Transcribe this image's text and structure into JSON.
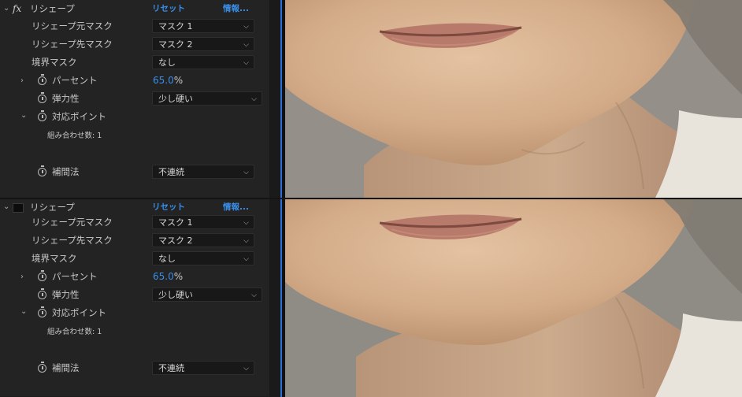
{
  "effects": [
    {
      "name": "リシェープ",
      "reset": "リセット",
      "info": "情報...",
      "source_mask_label": "リシェープ元マスク",
      "source_mask_value": "マスク 1",
      "dest_mask_label": "リシェープ先マスク",
      "dest_mask_value": "マスク 2",
      "boundary_mask_label": "境界マスク",
      "boundary_mask_value": "なし",
      "percent_label": "パーセント",
      "percent_value": "65.0",
      "percent_unit": "%",
      "elasticity_label": "弾力性",
      "elasticity_value": "少し硬い",
      "correspondence_label": "対応ポイント",
      "combinations_label": "組み合わせ数: 1",
      "interpolation_label": "補間法",
      "interpolation_value": "不連続"
    },
    {
      "name": "リシェープ",
      "reset": "リセット",
      "info": "情報...",
      "source_mask_label": "リシェープ元マスク",
      "source_mask_value": "マスク 1",
      "dest_mask_label": "リシェープ先マスク",
      "dest_mask_value": "マスク 2",
      "boundary_mask_label": "境界マスク",
      "boundary_mask_value": "なし",
      "percent_label": "パーセント",
      "percent_value": "65.0",
      "percent_unit": "%",
      "elasticity_label": "弾力性",
      "elasticity_value": "少し硬い",
      "correspondence_label": "対応ポイント",
      "combinations_label": "組み合わせ数: 1",
      "interpolation_label": "補間法",
      "interpolation_value": "不連続"
    }
  ],
  "icons": {
    "fx": "fx-icon",
    "chevron_down": "chevron-down-icon",
    "chevron_right": "chevron-right-icon",
    "stopwatch": "stopwatch-icon"
  },
  "colors": {
    "panel_bg": "#232323",
    "link": "#3a8ee8",
    "value": "#3a8ee8",
    "skin": "#d8b08e",
    "background": "#8f8c86"
  }
}
